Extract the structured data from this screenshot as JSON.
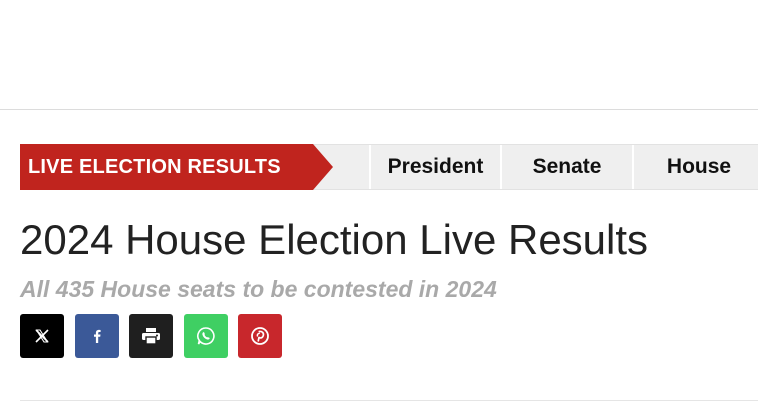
{
  "nav": {
    "banner": "LIVE ELECTION RESULTS",
    "tabs": [
      {
        "label": "President"
      },
      {
        "label": "Senate"
      },
      {
        "label": "House"
      }
    ]
  },
  "page": {
    "title": "2024 House Election Live Results",
    "subtitle": "All 435 House seats to be contested in 2024"
  },
  "share": [
    {
      "icon": "x-icon",
      "color": "#000000"
    },
    {
      "icon": "facebook-icon",
      "color": "#3b5998"
    },
    {
      "icon": "print-icon",
      "color": "#1f1f1f"
    },
    {
      "icon": "whatsapp-icon",
      "color": "#3fcf63"
    },
    {
      "icon": "pinterest-icon",
      "color": "#c8272c"
    }
  ],
  "colors": {
    "banner": "#c0241e",
    "nav_background": "#efefef",
    "subtitle": "#a9a9a9"
  }
}
